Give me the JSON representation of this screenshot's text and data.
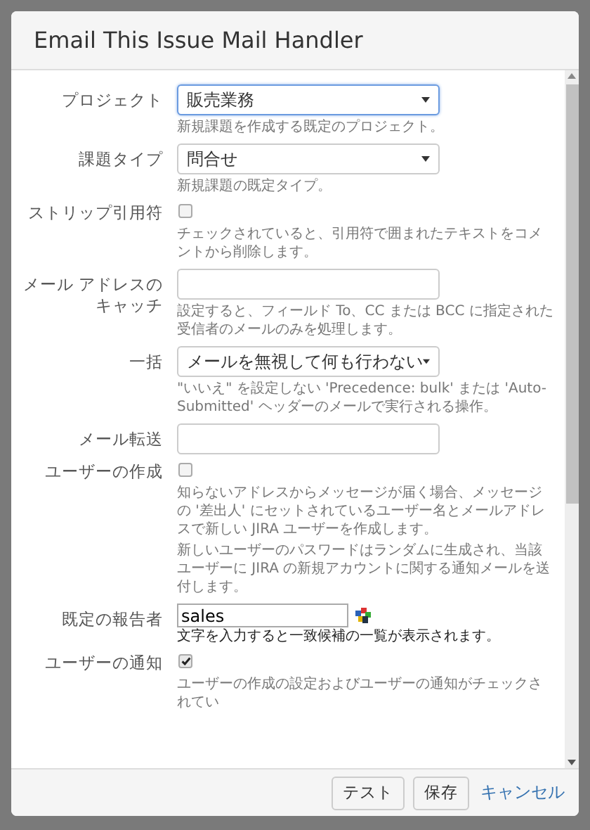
{
  "dialog": {
    "title": "Email This Issue Mail Handler"
  },
  "fields": [
    {
      "kind": "select",
      "label": "プロジェクト",
      "value": "販売業務",
      "focused": true,
      "help": [
        "新規課題を作成する既定のプロジェクト。"
      ]
    },
    {
      "kind": "select",
      "label": "課題タイプ",
      "value": "問合せ",
      "focused": false,
      "help": [
        "新規課題の既定タイプ。"
      ]
    },
    {
      "kind": "checkbox",
      "label": "ストリップ引用符",
      "checked": false,
      "help": [
        "チェックされていると、引用符で囲まれたテキストをコメントから削除します。"
      ]
    },
    {
      "kind": "text",
      "label": "メール アドレスのキャッチ",
      "help": [
        "設定すると、フィールド To、CC または BCC に指定された受信者のメールのみを処理します。"
      ]
    },
    {
      "kind": "select",
      "label": "一括",
      "value": "メールを無視して何も行わない",
      "focused": false,
      "help": [
        "\"いいえ\" を設定しない 'Precedence: bulk' または 'Auto-Submitted' ヘッダーのメールで実行される操作。"
      ]
    },
    {
      "kind": "text",
      "label": "メール転送"
    },
    {
      "kind": "checkbox",
      "label": "ユーザーの作成",
      "checked": false,
      "help": [
        "知らないアドレスからメッセージが届く場合、メッセージの '差出人' にセットされているユーザー名とメールアドレスで新しい JIRA ユーザーを作成します。",
        "新しいユーザーのパスワードはランダムに生成され、当該ユーザーに JIRA の新規アカウントに関する通知メールを送付します。"
      ]
    },
    {
      "kind": "user-picker",
      "label": "既定の報告者",
      "value": "sales",
      "help": [
        "文字を入力すると一致候補の一覧が表示されます。"
      ]
    },
    {
      "kind": "checkbox",
      "label": "ユーザーの通知",
      "checked": true,
      "help": [
        "ユーザーの作成の設定およびユーザーの通知がチェックされてい"
      ]
    }
  ],
  "buttons": [
    {
      "kind": "button",
      "label": "テスト"
    },
    {
      "kind": "button",
      "label": "保存"
    },
    {
      "kind": "link",
      "label": "キャンセル"
    }
  ]
}
